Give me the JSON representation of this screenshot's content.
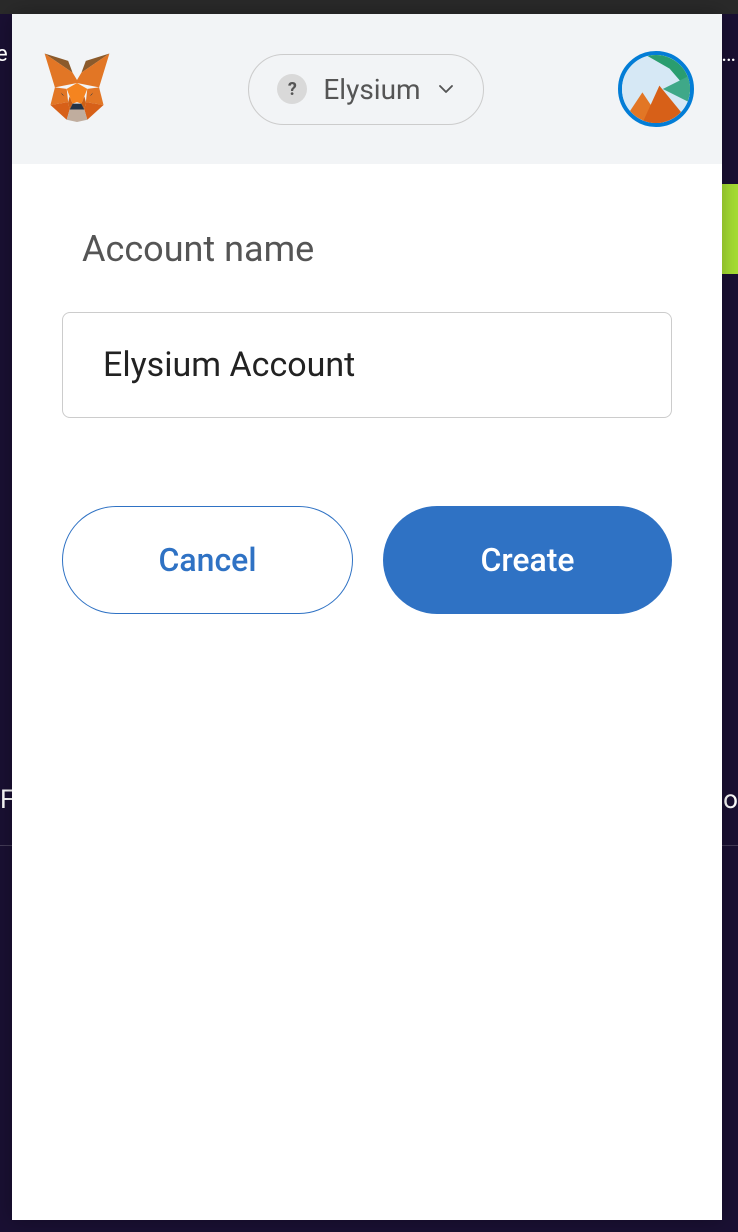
{
  "header": {
    "network_label": "Elysium",
    "network_icon_text": "?"
  },
  "form": {
    "label": "Account name",
    "value": "Elysium Account"
  },
  "buttons": {
    "cancel": "Cancel",
    "create": "Create"
  },
  "background": {
    "left_text": "F",
    "right_text": "o"
  },
  "colors": {
    "primary": "#2f72c4",
    "header_bg": "#f2f4f6",
    "page_bg": "#1a1033"
  }
}
